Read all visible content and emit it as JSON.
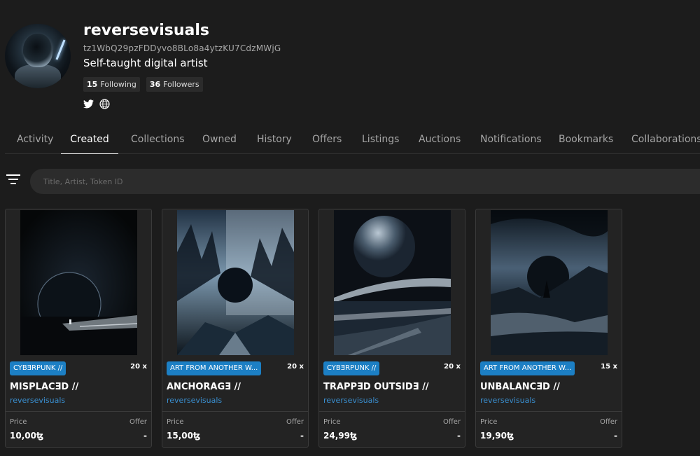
{
  "profile": {
    "username": "reversevisuals",
    "address": "tz1WbQ29pzFDDyvo8BLo8a4ytzKU7CdzMWjG",
    "bio": "Self-taught digital artist",
    "following_count": "15",
    "following_label": "Following",
    "followers_count": "36",
    "followers_label": "Followers",
    "social_icons": [
      "twitter-icon",
      "globe-icon"
    ]
  },
  "tabs": [
    "Activity",
    "Created",
    "Collections",
    "Owned",
    "History",
    "Offers",
    "Listings",
    "Auctions",
    "Notifications",
    "Bookmarks",
    "Collaborations"
  ],
  "active_tab": "Created",
  "search": {
    "placeholder": "Title, Artist, Token ID"
  },
  "cards": [
    {
      "tag": "CYBƎRPUNK //",
      "editions": "20 x",
      "title": "MISPLACƎD //",
      "creator": "reversevisuals",
      "price_label": "Price",
      "offer_label": "Offer",
      "price": "10,00ꜩ",
      "offer": "-"
    },
    {
      "tag": "ART FROM ANOTHER W...",
      "editions": "20 x",
      "title": "ANCHORAGƎ //",
      "creator": "reversevisuals",
      "price_label": "Price",
      "offer_label": "Offer",
      "price": "15,00ꜩ",
      "offer": "-"
    },
    {
      "tag": "CYBƎRPUNK //",
      "editions": "20 x",
      "title": "TRAPPƎD OUTSIDƎ //",
      "creator": "reversevisuals",
      "price_label": "Price",
      "offer_label": "Offer",
      "price": "24,99ꜩ",
      "offer": "-"
    },
    {
      "tag": "ART FROM ANOTHER W...",
      "editions": "15 x",
      "title": "UNBALANCƎD //",
      "creator": "reversevisuals",
      "price_label": "Price",
      "offer_label": "Offer",
      "price": "19,90ꜩ",
      "offer": "-"
    }
  ],
  "colors": {
    "background": "#1c1c1c",
    "card": "#232323",
    "tag": "#1c7fc4",
    "link": "#3a8fd0"
  }
}
